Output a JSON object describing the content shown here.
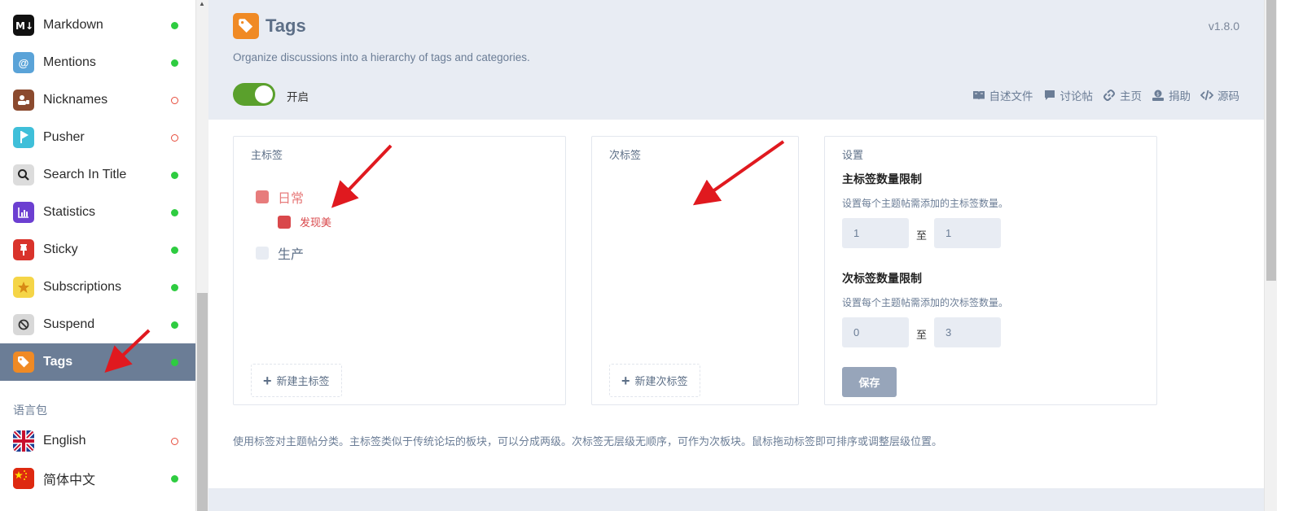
{
  "sidebar": {
    "items": [
      {
        "label": "Markdown",
        "icon": "markdown-icon",
        "status": "on",
        "icon_bg": "#111111"
      },
      {
        "label": "Mentions",
        "icon": "at-icon",
        "status": "on",
        "icon_bg": "#5aa3d8"
      },
      {
        "label": "Nicknames",
        "icon": "user-card-icon",
        "status": "off",
        "icon_bg": "#8b4a2e"
      },
      {
        "label": "Pusher",
        "icon": "pusher-icon",
        "status": "off",
        "icon_bg": "#3fbfd9"
      },
      {
        "label": "Search In Title",
        "icon": "search-icon",
        "status": "on",
        "icon_bg": "#dcdcdc"
      },
      {
        "label": "Statistics",
        "icon": "chart-icon",
        "status": "on",
        "icon_bg": "#6c3fd1"
      },
      {
        "label": "Sticky",
        "icon": "pin-icon",
        "status": "on",
        "icon_bg": "#d9332b"
      },
      {
        "label": "Subscriptions",
        "icon": "star-icon",
        "status": "on",
        "icon_bg": "#f5d547"
      },
      {
        "label": "Suspend",
        "icon": "ban-icon",
        "status": "on",
        "icon_bg": "#d8d8d8"
      },
      {
        "label": "Tags",
        "icon": "tag-icon",
        "status": "on",
        "icon_bg": "#f08a24",
        "active": true
      }
    ],
    "language_section_title": "语言包",
    "languages": [
      {
        "label": "English",
        "icon": "uk-flag-icon",
        "status": "off"
      },
      {
        "label": "简体中文",
        "icon": "china-flag-icon",
        "status": "on"
      }
    ]
  },
  "header": {
    "title": "Tags",
    "version": "v1.8.0",
    "description": "Organize discussions into a hierarchy of tags and categories.",
    "toggle_label": "开启",
    "toggle_on": true,
    "links": [
      {
        "label": "自述文件",
        "icon": "book-icon"
      },
      {
        "label": "讨论帖",
        "icon": "comment-icon"
      },
      {
        "label": "主页",
        "icon": "link-icon"
      },
      {
        "label": "捐助",
        "icon": "donate-icon"
      },
      {
        "label": "源码",
        "icon": "code-icon"
      }
    ]
  },
  "primary_tags": {
    "title": "主标签",
    "tags": [
      {
        "name": "日常",
        "color": "#e77c7c",
        "level": 0
      },
      {
        "name": "发现美",
        "color": "#d9484b",
        "level": 1
      },
      {
        "name": "生产",
        "color": "#e8ecf3",
        "level": 0
      }
    ],
    "new_button": "新建主标签"
  },
  "secondary_tags": {
    "title": "次标签",
    "new_button": "新建次标签"
  },
  "settings": {
    "title": "设置",
    "primary_heading": "主标签数量限制",
    "primary_help": "设置每个主题帖需添加的主标签数量。",
    "primary_min": "1",
    "primary_max": "1",
    "to_label": "至",
    "secondary_heading": "次标签数量限制",
    "secondary_help": "设置每个主题帖需添加的次标签数量。",
    "secondary_min": "0",
    "secondary_max": "3",
    "save_button": "保存"
  },
  "footer_note": "使用标签对主题帖分类。主标签类似于传统论坛的板块，可以分成两级。次标签无层级无顺序，可作为次板块。鼠标拖动标签即可排序或调整层级位置。",
  "colors": {
    "accent": "#f08a24",
    "sidebar_active": "#6b7d96",
    "toggle_on": "#5aa02c",
    "annotation_arrow": "#e0191f"
  }
}
